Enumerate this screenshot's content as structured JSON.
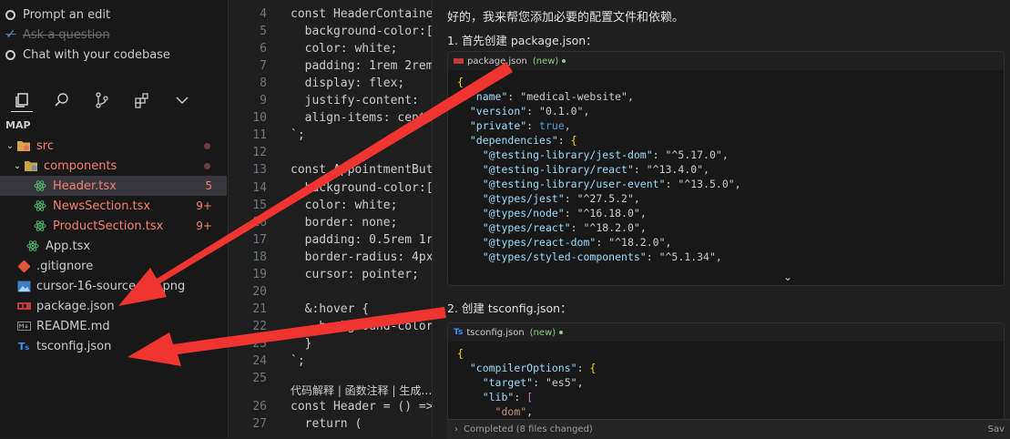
{
  "checklist": [
    {
      "label": "Prompt an edit",
      "done": false
    },
    {
      "label": "Ask a question",
      "done": true
    },
    {
      "label": "Chat with your codebase",
      "done": false
    }
  ],
  "explorer": {
    "section_title": "MAP",
    "items": [
      {
        "label": "src",
        "type": "folder-src",
        "color": "red",
        "badge": "",
        "dot": true
      },
      {
        "label": "components",
        "type": "folder-components",
        "color": "red",
        "badge": "",
        "dot": true
      },
      {
        "label": "Header.tsx",
        "type": "react",
        "color": "red",
        "badge": "5",
        "selected": true
      },
      {
        "label": "NewsSection.tsx",
        "type": "react",
        "color": "red",
        "badge": "9+"
      },
      {
        "label": "ProductSection.tsx",
        "type": "react",
        "color": "red",
        "badge": "9+"
      },
      {
        "label": "App.tsx",
        "type": "react",
        "color": "default",
        "badge": ""
      },
      {
        "label": ".gitignore",
        "type": "git",
        "color": "default",
        "badge": ""
      },
      {
        "label": "cursor-16-source-...n.png",
        "type": "image",
        "color": "default",
        "badge": ""
      },
      {
        "label": "package.json",
        "type": "npm",
        "color": "default",
        "badge": ""
      },
      {
        "label": "README.md",
        "type": "markdown",
        "color": "default",
        "badge": ""
      },
      {
        "label": "tsconfig.json",
        "type": "ts",
        "color": "default",
        "badge": ""
      }
    ]
  },
  "editor": {
    "lines": [
      {
        "n": "4",
        "text": "const HeaderContaine"
      },
      {
        "n": "5",
        "text": "  background-color:["
      },
      {
        "n": "6",
        "text": "  color: white;"
      },
      {
        "n": "7",
        "text": "  padding: 1rem 2rem"
      },
      {
        "n": "8",
        "text": "  display: flex;"
      },
      {
        "n": "9",
        "text": "  justify-content: "
      },
      {
        "n": "10",
        "text": "  align-items: cente"
      },
      {
        "n": "11",
        "text": "`;"
      },
      {
        "n": "12",
        "text": ""
      },
      {
        "n": "13",
        "text": "const AppointmentBut"
      },
      {
        "n": "14",
        "text": "  background-color:["
      },
      {
        "n": "15",
        "text": "  color: white;"
      },
      {
        "n": "16",
        "text": "  border: none;"
      },
      {
        "n": "17",
        "text": "  padding: 0.5rem 1r"
      },
      {
        "n": "18",
        "text": "  border-radius: 4px"
      },
      {
        "n": "19",
        "text": "  cursor: pointer;"
      },
      {
        "n": "20",
        "text": ""
      },
      {
        "n": "21",
        "text": "  &:hover {"
      },
      {
        "n": "22",
        "text": "    background-color"
      },
      {
        "n": "23",
        "text": "  }"
      },
      {
        "n": "24",
        "text": "`;"
      },
      {
        "n": "25",
        "text": ""
      },
      {
        "n": "26",
        "text": "const Header = () =>"
      },
      {
        "n": "27",
        "text": "  return ("
      }
    ],
    "codelens": "代码解释 | 函数注释 | 生成…"
  },
  "chat": {
    "intro": "好的，我来帮您添加必要的配置文件和依赖。",
    "step1": "1. 首先创建 package.json：",
    "step2": "2. 创建 tsconfig.json：",
    "card1": {
      "file": "package.json",
      "tag": "(new)",
      "lines": [
        "{",
        "  \"name\": \"medical-website\",",
        "  \"version\": \"0.1.0\",",
        "  \"private\": true,",
        "  \"dependencies\": {",
        "    \"@testing-library/jest-dom\": \"^5.17.0\",",
        "    \"@testing-library/react\": \"^13.4.0\",",
        "    \"@testing-library/user-event\": \"^13.5.0\",",
        "    \"@types/jest\": \"^27.5.2\",",
        "    \"@types/node\": \"^16.18.0\",",
        "    \"@types/react\": \"^18.2.0\",",
        "    \"@types/react-dom\": \"^18.2.0\",",
        "    \"@types/styled-components\": \"^5.1.34\","
      ]
    },
    "card2": {
      "file": "tsconfig.json",
      "tag": "(new)",
      "lines": [
        "{",
        "  \"compilerOptions\": {",
        "    \"target\": \"es5\",",
        "    \"lib\": [",
        "      \"dom\","
      ]
    },
    "status": "Completed (8 files changed)",
    "status_right": "Sav"
  },
  "colors": {
    "arrow": "#f0342f",
    "accent": "#3794ff"
  }
}
